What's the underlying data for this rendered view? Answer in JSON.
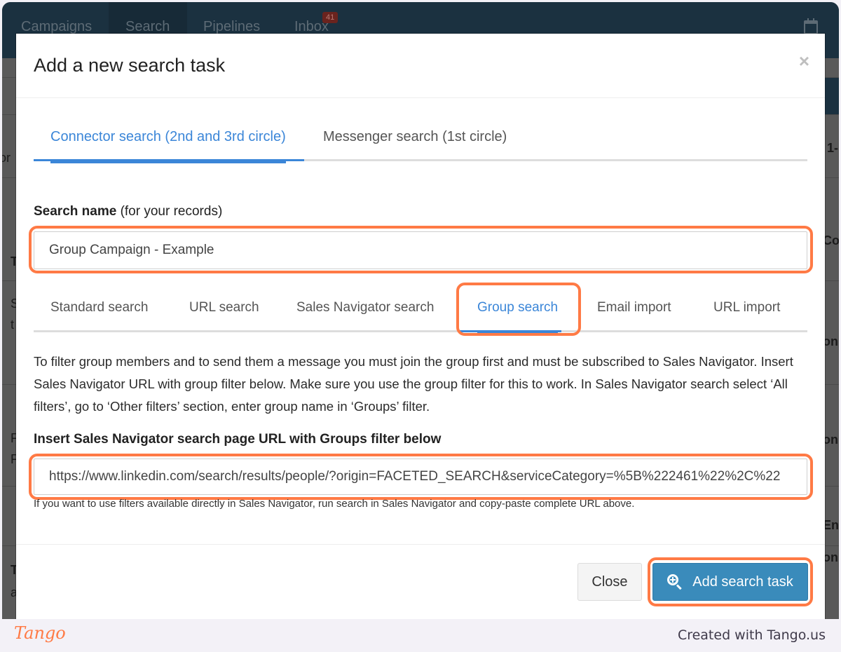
{
  "background_app": {
    "nav": [
      {
        "label": "Campaigns"
      },
      {
        "label": "Search"
      },
      {
        "label": "Pipelines"
      },
      {
        "label": "Inbox",
        "badge": "41"
      }
    ],
    "fragments": {
      "left": [
        "or",
        "T",
        "S",
        "t",
        "F",
        "F",
        "T",
        "a"
      ],
      "right": [
        "1-",
        "Co",
        "on",
        "on",
        "Ent",
        "on"
      ]
    }
  },
  "modal": {
    "title": "Add a new search task",
    "close_glyph": "×",
    "main_tabs": [
      {
        "label": "Connector search (2nd and 3rd circle)",
        "active": true
      },
      {
        "label": "Messenger search (1st circle)",
        "active": false
      }
    ],
    "search_name": {
      "label_bold": "Search name",
      "label_note": "(for your records)",
      "value": "Group Campaign - Example"
    },
    "sub_tabs": [
      {
        "label": "Standard search",
        "active": false
      },
      {
        "label": "URL search",
        "active": false
      },
      {
        "label": "Sales Navigator search",
        "active": false
      },
      {
        "label": "Group search",
        "active": true
      },
      {
        "label": "Email import",
        "active": false
      },
      {
        "label": "URL import",
        "active": false
      }
    ],
    "description": "To filter group members and to send them a message you must join the group first and must be subscribed to Sales Navigator. Insert Sales Navigator URL with group filter below. Make sure you use the group filter for this to work. In Sales Navigator search select ‘All filters’, go to ‘Other filters’ section, enter group name in ‘Groups’ filter.",
    "url_field": {
      "label": "Insert Sales Navigator search page URL with Groups filter below",
      "value": "https://www.linkedin.com/search/results/people/?origin=FACETED_SEARCH&serviceCategory=%5B%222461%22%2C%22",
      "help": "If you want to use filters available directly in Sales Navigator, run search in Sales Navigator and copy-paste complete URL above."
    },
    "buttons": {
      "close": "Close",
      "add": "Add search task"
    }
  },
  "colors": {
    "accent_blue": "#3b86d8",
    "primary_button": "#3a8bbb",
    "highlight_orange": "#ff7a45",
    "nav_bg": "#1b3140"
  },
  "footer": {
    "logo": "Tango",
    "credit": "Created with Tango.us"
  }
}
